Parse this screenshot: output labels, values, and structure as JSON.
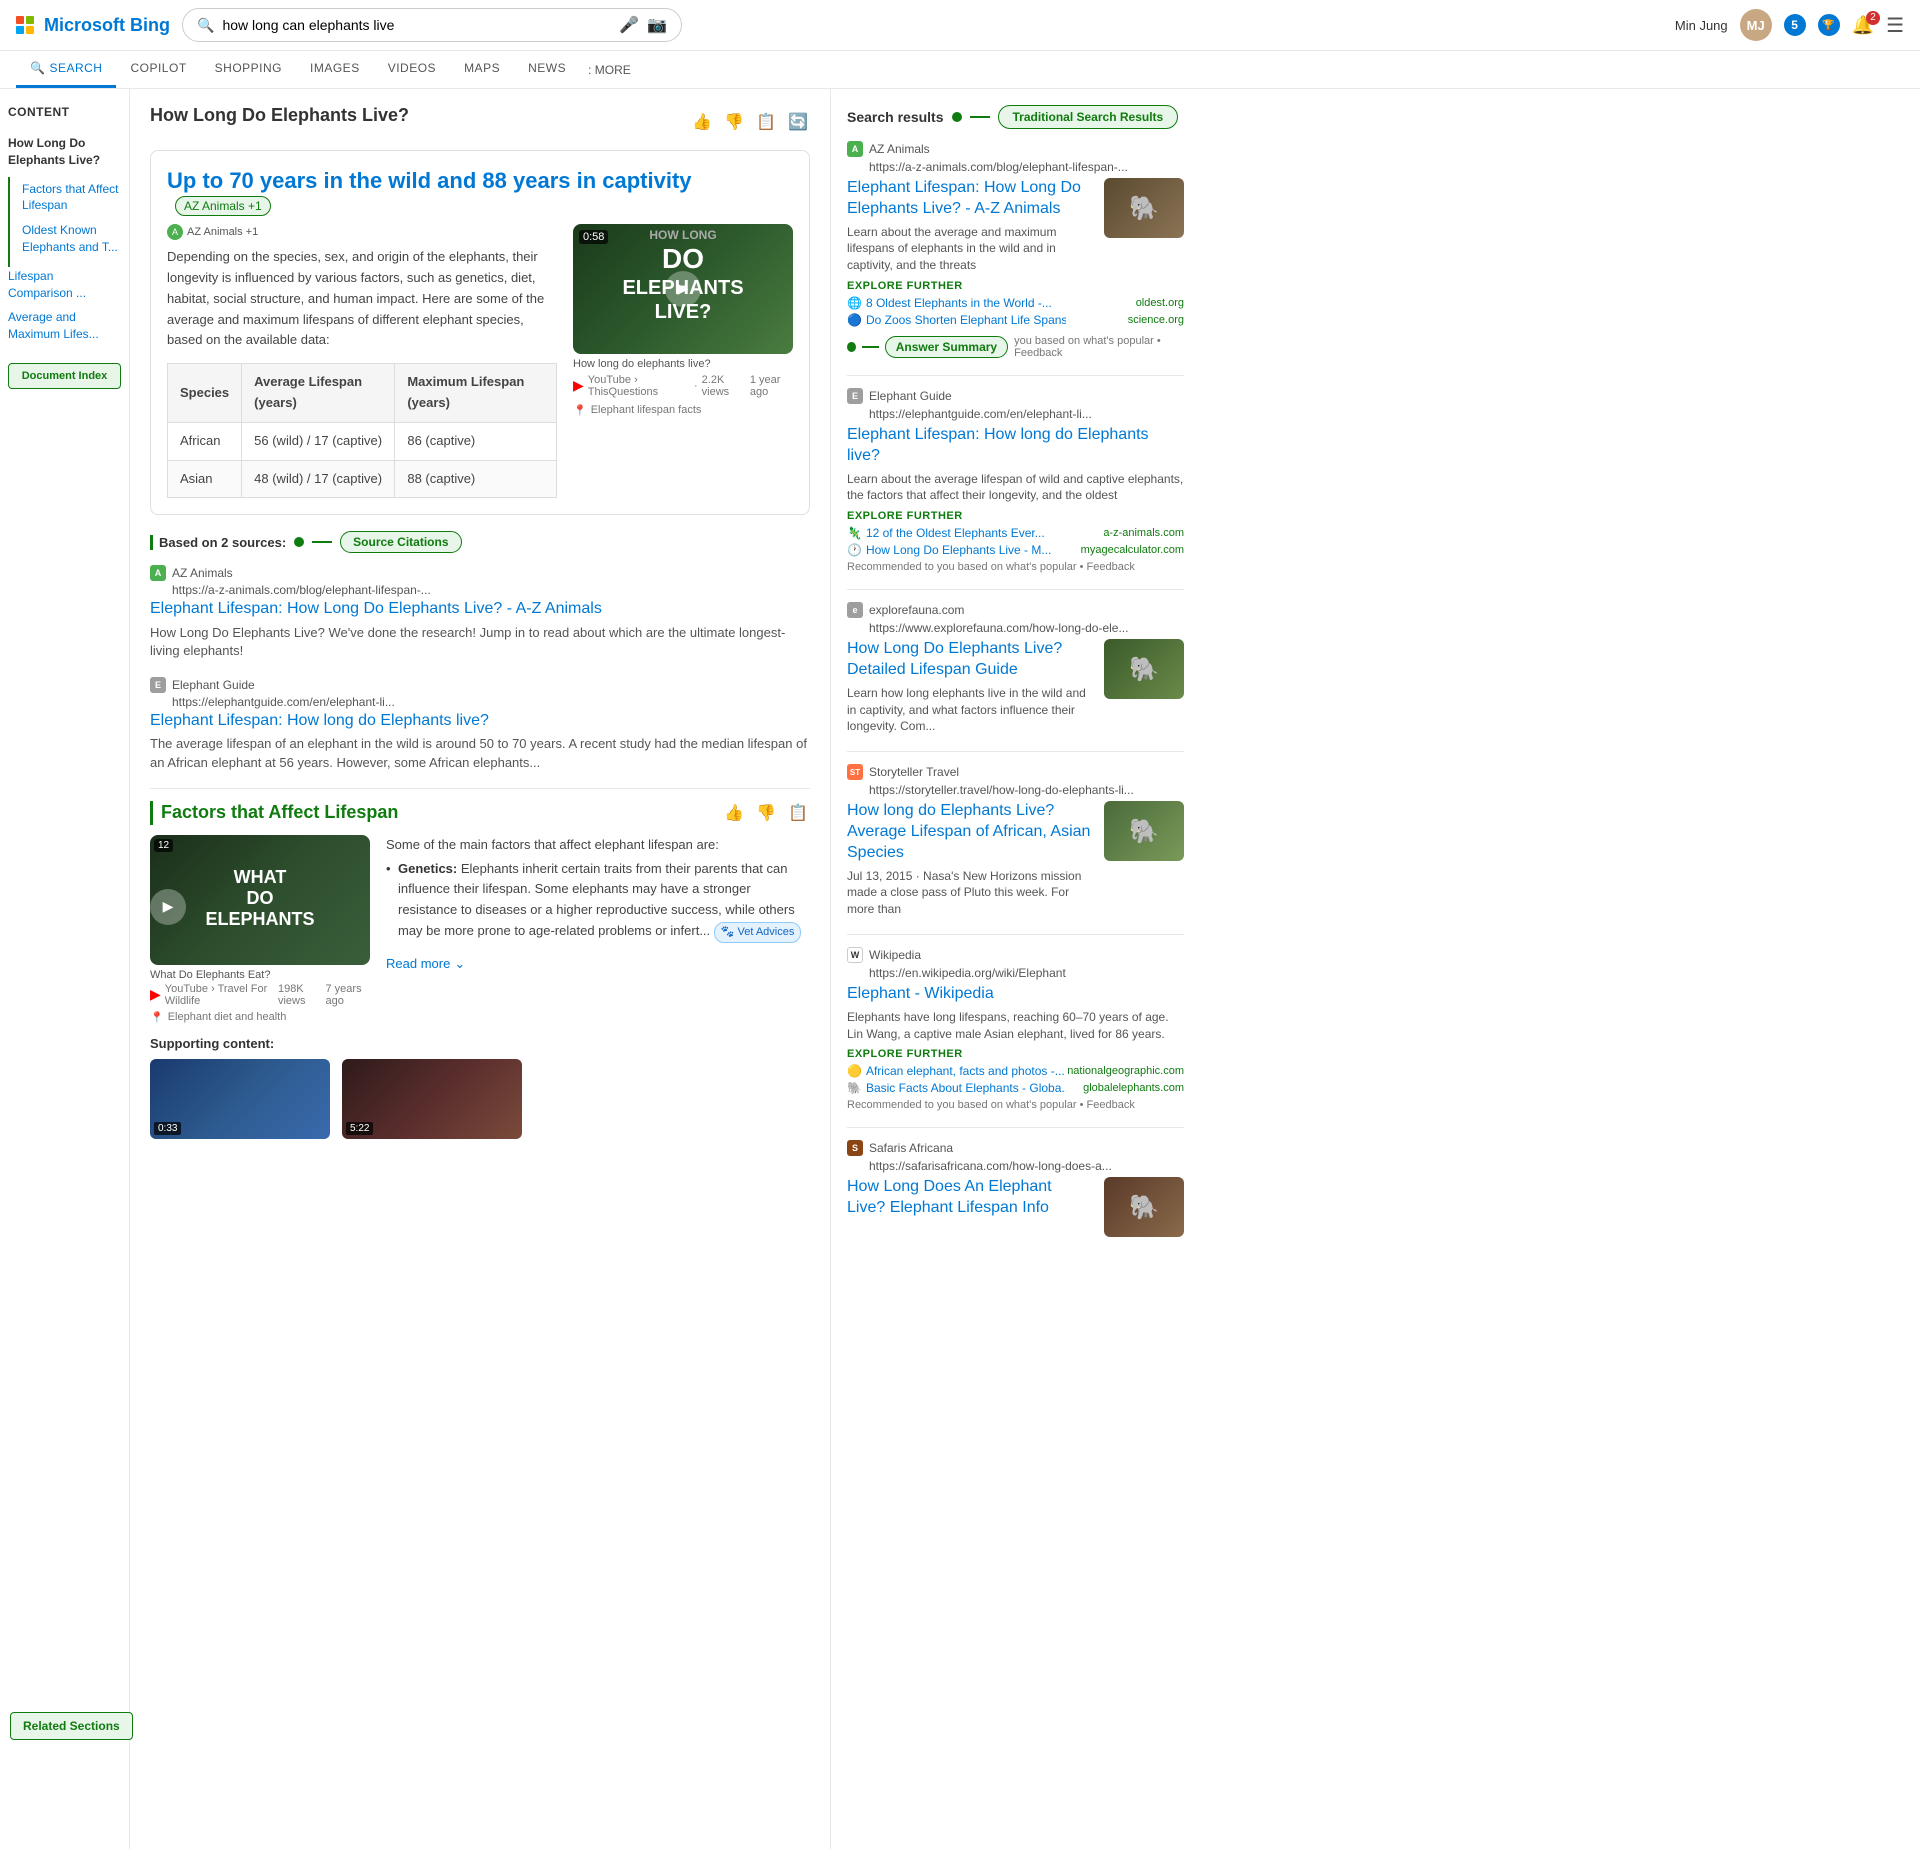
{
  "header": {
    "logo_text": "Microsoft Bing",
    "search_query": "how long can elephants live",
    "user_name": "Min Jung",
    "badge_count": "5",
    "notif_count": "2"
  },
  "navbar": {
    "items": [
      {
        "id": "search",
        "label": "SEARCH",
        "active": true
      },
      {
        "id": "copilot",
        "label": "COPILOT",
        "active": false
      },
      {
        "id": "shopping",
        "label": "SHOPPING",
        "active": false
      },
      {
        "id": "images",
        "label": "IMAGES",
        "active": false
      },
      {
        "id": "videos",
        "label": "VIDEOS",
        "active": false
      },
      {
        "id": "maps",
        "label": "MAPS",
        "active": false
      },
      {
        "id": "news",
        "label": "NEWS",
        "active": false
      }
    ],
    "more_label": ": MORE"
  },
  "sidebar": {
    "title": "Content",
    "items": [
      {
        "id": "how-long",
        "label": "How Long Do Elephants Live?",
        "active": true
      },
      {
        "id": "factors",
        "label": "Factors that Affect Lifespan"
      },
      {
        "id": "oldest",
        "label": "Oldest Known Elephants and T..."
      },
      {
        "id": "comparison",
        "label": "Lifespan Comparison ..."
      },
      {
        "id": "average",
        "label": "Average and Maximum Lifes..."
      }
    ],
    "doc_index_label": "Document Index",
    "related_sections_label": "Related Sections"
  },
  "answer_section": {
    "title": "How Long Do Elephants Live?",
    "headline": "Up to 70 years in the wild and 88 years in captivity",
    "source_badge": "AZ Animals +1",
    "body": "Depending on the species, sex, and origin of the elephants, their longevity is influenced by various factors, such as genetics, diet, habitat, social structure, and human impact. Here are some of the average and maximum lifespans of different elephant species, based on the available data:",
    "sources_count": "Based on 2 sources:",
    "source_citations_label": "Source Citations",
    "video": {
      "duration": "0:58",
      "title": "HOW LONG DO ELEPHANTS LIVE?",
      "caption": "How long do elephants live?",
      "yt_channel": "YouTube › ThisQuestions",
      "views": "2.2K views",
      "time_ago": "1 year ago"
    },
    "location_label": "Elephant lifespan facts",
    "table": {
      "headers": [
        "Species",
        "Average Lifespan (years)",
        "Maximum Lifespan (years)"
      ],
      "rows": [
        {
          "species": "African",
          "average": "56 (wild) / 17 (captive)",
          "maximum": "86 (captive)"
        },
        {
          "species": "Asian",
          "average": "48 (wild) / 17 (captive)",
          "maximum": "88 (captive)"
        }
      ]
    },
    "sources": [
      {
        "favicon_letter": "A",
        "name": "AZ Animals",
        "url": "https://a-z-animals.com/blog/elephant-lifespan-...",
        "link_text": "Elephant Lifespan: How Long Do Elephants Live? - A-Z Animals",
        "desc": "How Long Do Elephants Live? We've done the research! Jump in to read about which are the ultimate longest-living elephants!"
      },
      {
        "favicon_letter": "E",
        "name": "Elephant Guide",
        "url": "https://elephantguide.com/en/elephant-li...",
        "link_text": "Elephant Lifespan: How long do Elephants live?",
        "desc": "The average lifespan of an elephant in the wild is around 50 to 70 years. A recent study had the median lifespan of an African elephant at 56 years. However, some African elephants..."
      }
    ]
  },
  "factors_section": {
    "heading": "Factors that Affect Lifespan",
    "video": {
      "duration": "12",
      "title": "WHAT DO ELEPHANTS",
      "subtitle": "What Do Elephants Eat?",
      "yt_channel": "YouTube › Travel For Wildlife",
      "views": "198K views",
      "time_ago": "7 years ago"
    },
    "location_label": "Elephant diet and health",
    "intro": "Some of the main factors that affect elephant lifespan are:",
    "bullets": [
      {
        "key": "Genetics:",
        "text": "Elephants inherit certain traits from their parents that can influence their lifespan. Some elephants may have a stronger resistance to diseases or a higher reproductive success, while others may be more prone to age-related problems or infert..."
      }
    ],
    "vet_badge": "Vet Advices",
    "read_more_label": "Read more",
    "supporting_label": "Supporting content:",
    "thumb1_duration": "0:33",
    "thumb2_duration": "5:22"
  },
  "right_panel": {
    "search_results_label": "Search results",
    "trad_results_label": "Traditional Search Results",
    "answer_summary_label": "Answer Summary",
    "results": [
      {
        "id": "az-animals",
        "favicon_letter": "A",
        "favicon_type": "green",
        "source_name": "AZ Animals",
        "source_url": "https://a-z-animals.com/blog/elephant-lifespan-...",
        "link_text": "Elephant Lifespan: How Long Do Elephants Live? - A-Z Animals",
        "desc": "Learn about the average and maximum lifespans of elephants in the wild and in captivity, and the threats",
        "has_image": true,
        "image_alt": "elephant",
        "explore_more": true,
        "explore_links": [
          {
            "text": "8 Oldest Elephants in the World -...",
            "domain": "oldest.org"
          },
          {
            "text": "Do Zoos Shorten Elephant Life Spans?",
            "domain": "science.org"
          }
        ]
      },
      {
        "id": "elephant-guide",
        "favicon_letter": "E",
        "favicon_type": "grey",
        "source_name": "Elephant Guide",
        "source_url": "https://elephantguide.com/en/elephant-li...",
        "link_text": "Elephant Lifespan: How long do Elephants live?",
        "desc": "Learn about the average lifespan of wild and captive elephants, the factors that affect their longevity, and the oldest",
        "has_image": false,
        "explore_more": true,
        "explore_links": [
          {
            "text": "12 of the Oldest Elephants Ever...",
            "domain": "a-z-animals.com"
          },
          {
            "text": "How Long Do Elephants Live - M...",
            "domain": "myagecalculator.com"
          }
        ],
        "recommendation": "Recommended to you based on what's popular • Feedback"
      },
      {
        "id": "explorefauna",
        "favicon_letter": "e",
        "favicon_type": "grey",
        "source_name": "explorefauna.com",
        "source_url": "https://www.explorefauna.com/how-long-do-ele...",
        "link_text": "How Long Do Elephants Live? Detailed Lifespan Guide",
        "desc": "Learn how long elephants live in the wild and in captivity, and what factors influence their longevity. Com...",
        "has_image": true,
        "image_alt": "elephants walking"
      },
      {
        "id": "storyteller",
        "favicon_letter": "ST",
        "favicon_type": "st",
        "source_name": "Storyteller Travel",
        "source_url": "https://storyteller.travel/how-long-do-elephants-li...",
        "link_text": "How long do Elephants Live? Average Lifespan of African, Asian Species",
        "desc": "Jul 13, 2015 · Nasa's New Horizons mission made a close pass of Pluto this week. For more than",
        "has_image": true,
        "image_alt": "elephant in nature"
      },
      {
        "id": "wikipedia",
        "favicon_letter": "W",
        "favicon_type": "wiki",
        "source_name": "Wikipedia",
        "source_url": "https://en.wikipedia.org/wiki/Elephant",
        "link_text": "Elephant - Wikipedia",
        "desc": "Elephants have long lifespans, reaching 60–70 years of age. Lin Wang, a captive male Asian elephant, lived for 86 years.",
        "has_image": false,
        "explore_more": true,
        "explore_links": [
          {
            "text": "African elephant, facts and photos -...",
            "domain": "nationalgeographic.com"
          },
          {
            "text": "Basic Facts About Elephants - Globa...",
            "domain": "globalelephants.com"
          }
        ],
        "recommendation": "Recommended to you based on what's popular • Feedback"
      },
      {
        "id": "safaris-africana",
        "favicon_letter": "S",
        "favicon_type": "safari",
        "source_name": "Safaris Africana",
        "source_url": "https://safarisafricana.com/how-long-does-a...",
        "link_text": "How Long Does An Elephant Live? Elephant Lifespan Info",
        "desc": "",
        "has_image": true,
        "image_alt": "elephant"
      }
    ]
  }
}
